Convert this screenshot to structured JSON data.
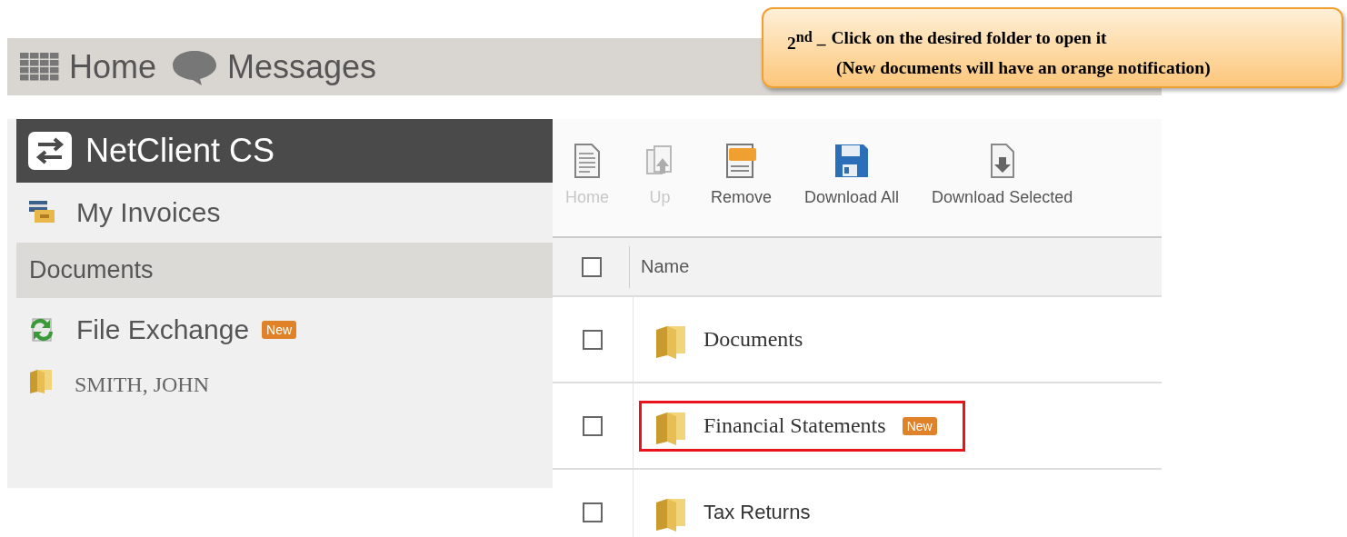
{
  "top_nav": [
    {
      "label": "Home",
      "kind": "home"
    },
    {
      "label": "Messages",
      "kind": "messages"
    }
  ],
  "callout": {
    "ordinal": "2$^{nd}$ –",
    "line_1": "Click on the desired folder to open it",
    "line_2": "(New documents will have an orange notification)"
  },
  "sidebar": {
    "title": "NetClient CS",
    "items": [
      {
        "label": "My Invoices",
        "kind": "invoices"
      },
      {
        "label": "Documents",
        "kind": "section"
      },
      {
        "label": "File Exchange",
        "kind": "exchange",
        "badge": "New"
      },
      {
        "label": "SMITH, JOHN",
        "kind": "folder"
      }
    ]
  },
  "toolbar": [
    {
      "label": "Home",
      "kind": "page",
      "disabled": true
    },
    {
      "label": "Up",
      "kind": "up",
      "disabled": true
    },
    {
      "label": "Remove",
      "kind": "remove",
      "disabled": false
    },
    {
      "label": "Download All",
      "kind": "save",
      "disabled": false
    },
    {
      "label": "Download Selected",
      "kind": "download",
      "disabled": false
    }
  ],
  "table": {
    "columns": [
      "Name"
    ],
    "header_checked": false,
    "rows": [
      {
        "name": "Documents",
        "checked": false,
        "highlighted": false,
        "serif": true
      },
      {
        "name": "Financial Statements",
        "checked": false,
        "highlighted": true,
        "serif": true,
        "badge": "New"
      },
      {
        "name": "Tax Returns",
        "checked": false,
        "highlighted": false,
        "serif": false
      }
    ]
  }
}
